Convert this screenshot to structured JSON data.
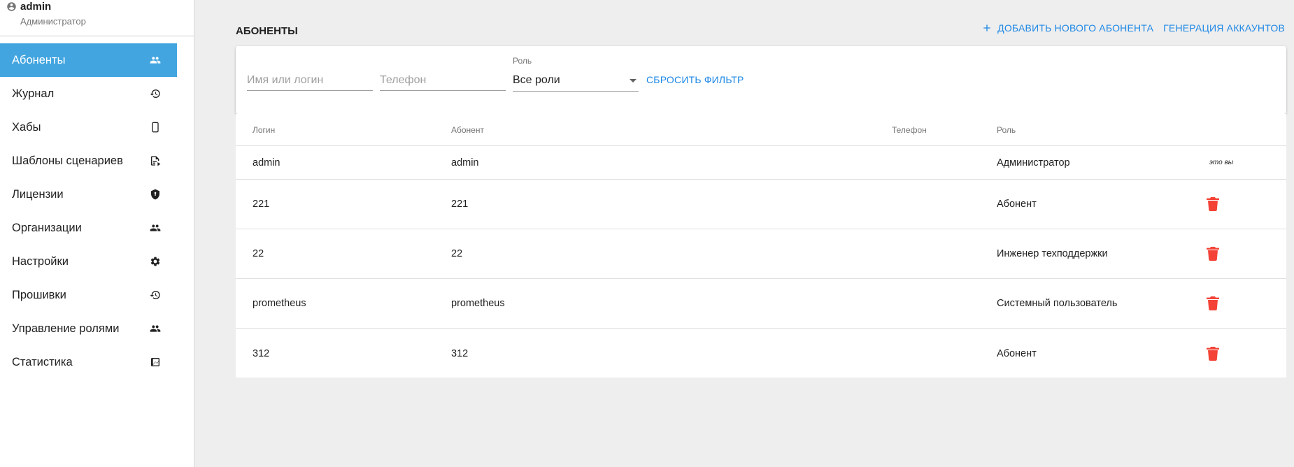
{
  "user": {
    "name": "admin",
    "role": "Администратор"
  },
  "nav": {
    "items": [
      {
        "label": "Абоненты",
        "icon": "people-icon"
      },
      {
        "label": "Журнал",
        "icon": "history-icon"
      },
      {
        "label": "Хабы",
        "icon": "phone-device-icon"
      },
      {
        "label": "Шаблоны сценариев",
        "icon": "script-icon"
      },
      {
        "label": "Лицензии",
        "icon": "shield-icon"
      },
      {
        "label": "Организации",
        "icon": "people-icon"
      },
      {
        "label": "Настройки",
        "icon": "gear-icon"
      },
      {
        "label": "Прошивки",
        "icon": "history-icon"
      },
      {
        "label": "Управление ролями",
        "icon": "people-icon"
      },
      {
        "label": "Статистика",
        "icon": "chart-icon"
      }
    ],
    "active_index": 0
  },
  "page": {
    "title": "АБОНЕНТЫ",
    "add_button": "ДОБАВИТЬ НОВОГО АБОНЕНТА",
    "generate_button": "ГЕНЕРАЦИЯ АККАУНТОВ"
  },
  "filters": {
    "name_placeholder": "Имя или логин",
    "phone_placeholder": "Телефон",
    "role_label": "Роль",
    "role_value": "Все роли",
    "reset_label": "СБРОСИТЬ ФИЛЬТР"
  },
  "table": {
    "headers": {
      "login": "Логин",
      "subscriber": "Абонент",
      "phone": "Телефон",
      "role": "Роль"
    },
    "rows": [
      {
        "login": "admin",
        "subscriber": "admin",
        "phone": "",
        "role": "Администратор",
        "note": "это вы"
      },
      {
        "login": "221",
        "subscriber": "221",
        "phone": "",
        "role": "Абонент"
      },
      {
        "login": "22",
        "subscriber": "22",
        "phone": "",
        "role": "Инженер техподдержки"
      },
      {
        "login": "prometheus",
        "subscriber": "prometheus",
        "phone": "",
        "role": "Системный пользователь"
      },
      {
        "login": "312",
        "subscriber": "312",
        "phone": "",
        "role": "Абонент"
      }
    ]
  },
  "colors": {
    "accent": "#42a5e0",
    "link": "#1e88e5",
    "delete": "#f44336",
    "background": "#eeeeee"
  }
}
